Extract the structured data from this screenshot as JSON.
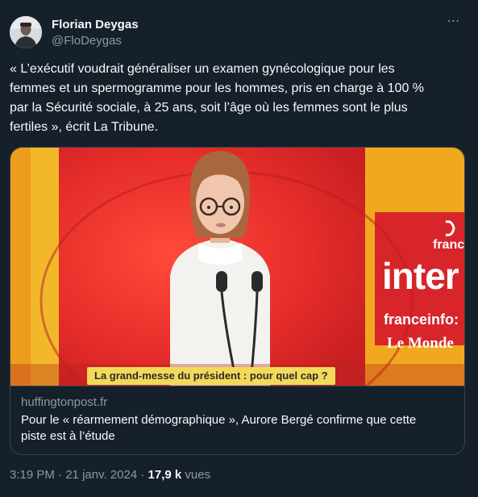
{
  "author": {
    "display_name": "Florian Deygas",
    "handle": "@FloDeygas"
  },
  "tweet": {
    "text_lines": [
      "« L’exécutif voudrait généraliser un examen gynécologique pour les",
      "femmes et un spermogramme pour les hommes, pris en charge à 100 %",
      "par la Sécurité sociale, à 25 ans, soit l’âge où les femmes sont le plus",
      "fertiles », écrit La Tribune."
    ],
    "more_icon": "⋯"
  },
  "card": {
    "media": {
      "caption": "La grand-messe du président : pour quel cap ?",
      "logo_france": "france",
      "logo_inter": "inter",
      "logo_franceinfo": "franceinfo:",
      "logo_lemonde": "Le Monde"
    },
    "domain": "huffingtonpost.fr",
    "title_line1": "Pour le « réarmement démographique », Aurore Bergé confirme que cette",
    "title_line2": "piste est à l’étude"
  },
  "meta": {
    "time": "3:19 PM",
    "separator": " · ",
    "date": "21 janv. 2024",
    "separator2": " · ",
    "views_count": "17,9 k",
    "views_label": " vues"
  },
  "colors": {
    "background": "#15202b",
    "text_primary": "#f7f9f9",
    "text_secondary": "#8b98a5",
    "border": "#38444d",
    "caption_bg": "#f3d95a",
    "studio_red": "#e62d2a"
  }
}
